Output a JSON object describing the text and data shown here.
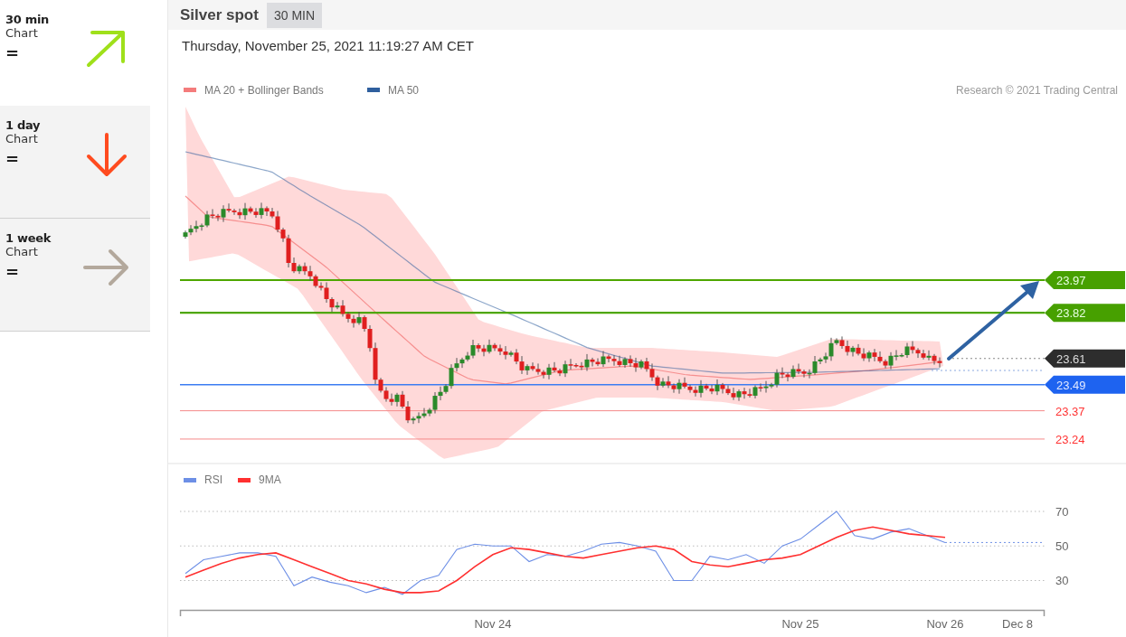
{
  "sidebar": {
    "items": [
      {
        "title": "30 min",
        "subtitle": "Chart",
        "rating": "=",
        "kind": "up",
        "selected": true
      },
      {
        "title": "1 day",
        "subtitle": "Chart",
        "rating": "=",
        "kind": "down",
        "selected": false
      },
      {
        "title": "1 week",
        "subtitle": "Chart",
        "rating": "=",
        "kind": "flat",
        "selected": false
      }
    ]
  },
  "header": {
    "title": "Silver spot",
    "timeframe": "30 MIN"
  },
  "timestamp": "Thursday, November 25, 2021 11:19:27 AM CET",
  "price_chart": {
    "legend": [
      {
        "label": "MA 20 + Bollinger Bands",
        "color": "#f47c7c"
      },
      {
        "label": "MA 50",
        "color": "#2f5f9e"
      }
    ],
    "credit": "Research © 2021 Trading Central",
    "levels": [
      {
        "value": "23.97",
        "kind": "resistance"
      },
      {
        "value": "23.82",
        "kind": "resistance"
      },
      {
        "value": "23.61",
        "kind": "last"
      },
      {
        "value": "23.49",
        "kind": "support"
      },
      {
        "value": "23.37",
        "kind": "minor"
      },
      {
        "value": "23.24",
        "kind": "minor"
      }
    ]
  },
  "rsi_panel": {
    "chart_data": {
      "type": "line",
      "categories": [
        null,
        null,
        null,
        null,
        null,
        null,
        null,
        null,
        null,
        null,
        null,
        null,
        null,
        null,
        null,
        null,
        null,
        "Nov 24",
        null,
        null,
        null,
        null,
        null,
        null,
        null,
        null,
        null,
        null,
        null,
        null,
        null,
        null,
        null,
        null,
        "Nov 25",
        null,
        null,
        null,
        null,
        null,
        null,
        null,
        "Nov 26",
        null,
        null,
        null,
        "Dec 8",
        null
      ],
      "series": [
        {
          "name": "RSI",
          "color": "#6d8fe6",
          "values": [
            34,
            42,
            44,
            46,
            46,
            44,
            27,
            32,
            29,
            27,
            23,
            26,
            22,
            30,
            33,
            48,
            51,
            50,
            50,
            41,
            45,
            44,
            47,
            51,
            52,
            50,
            47,
            30,
            30,
            44,
            42,
            45,
            40,
            50,
            54,
            62,
            70,
            56,
            54,
            58,
            60,
            56,
            52,
            null,
            null,
            null,
            null,
            null
          ]
        },
        {
          "name": "9MA",
          "color": "#ff3030",
          "values": [
            32,
            36,
            40,
            43,
            45,
            46,
            42,
            38,
            34,
            30,
            28,
            25,
            23,
            23,
            24,
            30,
            38,
            45,
            49,
            48,
            46,
            44,
            43,
            45,
            47,
            49,
            50,
            48,
            41,
            39,
            38,
            40,
            42,
            43,
            45,
            50,
            55,
            59,
            61,
            59,
            57,
            56,
            55,
            null,
            null,
            null,
            null,
            null
          ]
        }
      ],
      "ylim": [
        13,
        70
      ],
      "grid": true,
      "legend": true,
      "ref_lines": [
        {
          "axis": "y",
          "value": 52,
          "color": "#6d8fe6"
        }
      ],
      "yticks": [
        30,
        50,
        70
      ]
    }
  }
}
